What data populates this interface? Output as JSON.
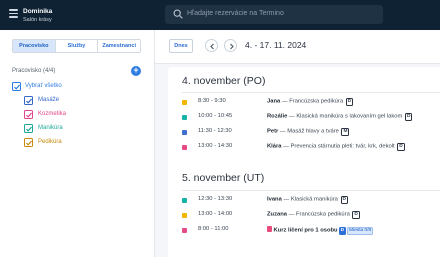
{
  "topbar": {
    "user_name": "Dominika",
    "salon_name": "Salón krásy",
    "search_placeholder": "Hľadajte rezervácie na Termino"
  },
  "sidebar": {
    "tabs": [
      {
        "label": "Pracovisko",
        "active": true
      },
      {
        "label": "Služby",
        "active": false
      },
      {
        "label": "Zamestnanci",
        "active": false
      }
    ],
    "section_title": "Pracovisko (4/4)",
    "select_all_label": "Vybrať všetko",
    "items": [
      {
        "label": "Masáže",
        "color": "#3568c8"
      },
      {
        "label": "Kozmetika",
        "color": "#e0478d"
      },
      {
        "label": "Manikúra",
        "color": "#1fa89b"
      },
      {
        "label": "Pedikúra",
        "color": "#c98a0e"
      }
    ]
  },
  "toolbar": {
    "today_label": "Dnes",
    "date_range": "4. - 17. 11. 2024"
  },
  "days": [
    {
      "title": "4. november (PO)",
      "events": [
        {
          "color": "#f2b705",
          "time": "8:30 - 9:30",
          "name": "Jana",
          "service": " — Francúzska pedikúra ",
          "tag": "D"
        },
        {
          "color": "#17b3a8",
          "time": "10:00 - 10:45",
          "name": "Rozálie",
          "service": " — Klasická manikúra s lakovaním gel lakom ",
          "tag": "D"
        },
        {
          "color": "#3f6fd0",
          "time": "11:30 - 12:30",
          "name": "Petr",
          "service": " — Masáž hlavy a tváre ",
          "tag": "M"
        },
        {
          "color": "#e64a87",
          "time": "13:00 - 14:30",
          "name": "Klára",
          "service": " — Prevencia stárnutia pleti: tvár, krk, dekolt ",
          "tag": "D"
        }
      ]
    },
    {
      "title": "5. november (UT)",
      "events": [
        {
          "color": "#17b3a8",
          "time": "12:30 - 13:30",
          "name": "Ivana",
          "service": " — Klasická manikúra ",
          "tag": "D"
        },
        {
          "color": "#f2b705",
          "time": "13:00 - 14:00",
          "name": "Zuzana",
          "service": " — Francúzska pedikúra ",
          "tag": "D"
        },
        {
          "color": "#e64a87",
          "time": "8:00 - 11:00",
          "name": "Kurz líčení pro 1 osobu",
          "service": "",
          "tag": "D",
          "capacity": "Miesta 0/8",
          "course": true
        }
      ]
    }
  ]
}
